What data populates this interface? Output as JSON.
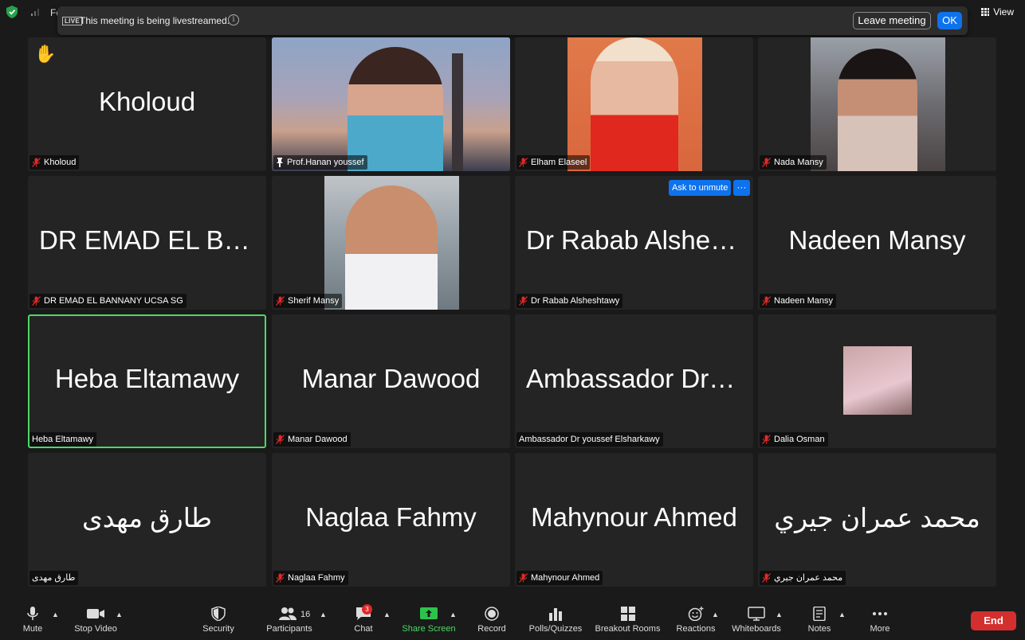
{
  "top": {
    "app_title": "Fo",
    "view_label": "View"
  },
  "banner": {
    "live_badge": "LIVE",
    "message": "This meeting is being livestreamed.",
    "leave_label": "Leave meeting",
    "ok_label": "OK"
  },
  "tiles": [
    {
      "big": "Kholoud",
      "label": "Kholoud"
    },
    {
      "big": "",
      "label": "Prof.Hanan youssef"
    },
    {
      "big": "",
      "label": "Elham Elaseel"
    },
    {
      "big": "",
      "label": "Nada Mansy"
    },
    {
      "big": "DR EMAD EL BAN...",
      "label": "DR EMAD EL BANNANY UCSA SG"
    },
    {
      "big": "",
      "label": "Sherif Mansy"
    },
    {
      "big": "Dr Rabab Alsheshtawy",
      "label": "Dr Rabab Alsheshtawy"
    },
    {
      "big": "Nadeen Mansy",
      "label": "Nadeen Mansy"
    },
    {
      "big": "Heba Eltamawy",
      "label": "Heba Eltamawy"
    },
    {
      "big": "Manar Dawood",
      "label": "Manar Dawood"
    },
    {
      "big": "Ambassador Dr youssef Elsharkawy",
      "label": "Ambassador Dr youssef Elsharkawy"
    },
    {
      "big": "",
      "label": "Dalia Osman"
    },
    {
      "big": "طارق  مهدى",
      "label": "طارق  مهدى"
    },
    {
      "big": "Naglaa Fahmy",
      "label": "Naglaa Fahmy"
    },
    {
      "big": "Mahynour Ahmed",
      "label": "Mahynour Ahmed"
    },
    {
      "big": "محمد عمران جيري",
      "label": "محمد عمران جيري"
    }
  ],
  "ask_unmute_label": "Ask to unmute",
  "more_dots": "···",
  "toolbar": {
    "mute": "Mute",
    "stop_video": "Stop Video",
    "security": "Security",
    "participants": "Participants",
    "participants_count": "16",
    "chat": "Chat",
    "chat_badge": "3",
    "share_screen": "Share Screen",
    "record": "Record",
    "polls": "Polls/Quizzes",
    "breakout": "Breakout Rooms",
    "reactions": "Reactions",
    "whiteboards": "Whiteboards",
    "notes": "Notes",
    "more": "More",
    "end": "End"
  },
  "colors": {
    "accent_blue": "#0e72ed",
    "active_speaker_green": "#4cd964",
    "end_red": "#d32f2f",
    "mute_red": "#e02828"
  }
}
